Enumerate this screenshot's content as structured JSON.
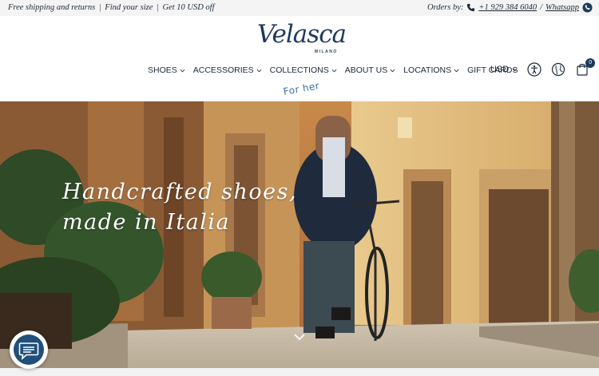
{
  "topbar": {
    "promo_shipping": "Free shipping and returns",
    "promo_size": "Find your size",
    "promo_offer": "Get 10 USD off",
    "separator": "|",
    "orders_label": "Orders by:",
    "phone": "+1 929 384 6040",
    "whatsapp": "Whatsapp",
    "slash": "/"
  },
  "header": {
    "logo_text": "Velasca",
    "logo_sub": "MILANO",
    "nav": [
      {
        "label": "SHOES"
      },
      {
        "label": "ACCESSORIES"
      },
      {
        "label": "COLLECTIONS"
      },
      {
        "label": "ABOUT US"
      },
      {
        "label": "LOCATIONS"
      },
      {
        "label": "GIFT CARDS"
      }
    ],
    "for_her": "For her",
    "currency": "USD",
    "cart_count": "0",
    "icons": [
      "phone-icon",
      "whatsapp-icon",
      "accessibility-icon",
      "globe-icon",
      "cart-icon",
      "user-icon",
      "chevron-down-icon",
      "chat-icon"
    ]
  },
  "hero": {
    "line1": "Handcrafted shoes,",
    "line2": "made in Italia"
  },
  "colors": {
    "brand": "#1d3a5c",
    "accent": "#3a6fa0",
    "chat": "#1f4f7a"
  }
}
